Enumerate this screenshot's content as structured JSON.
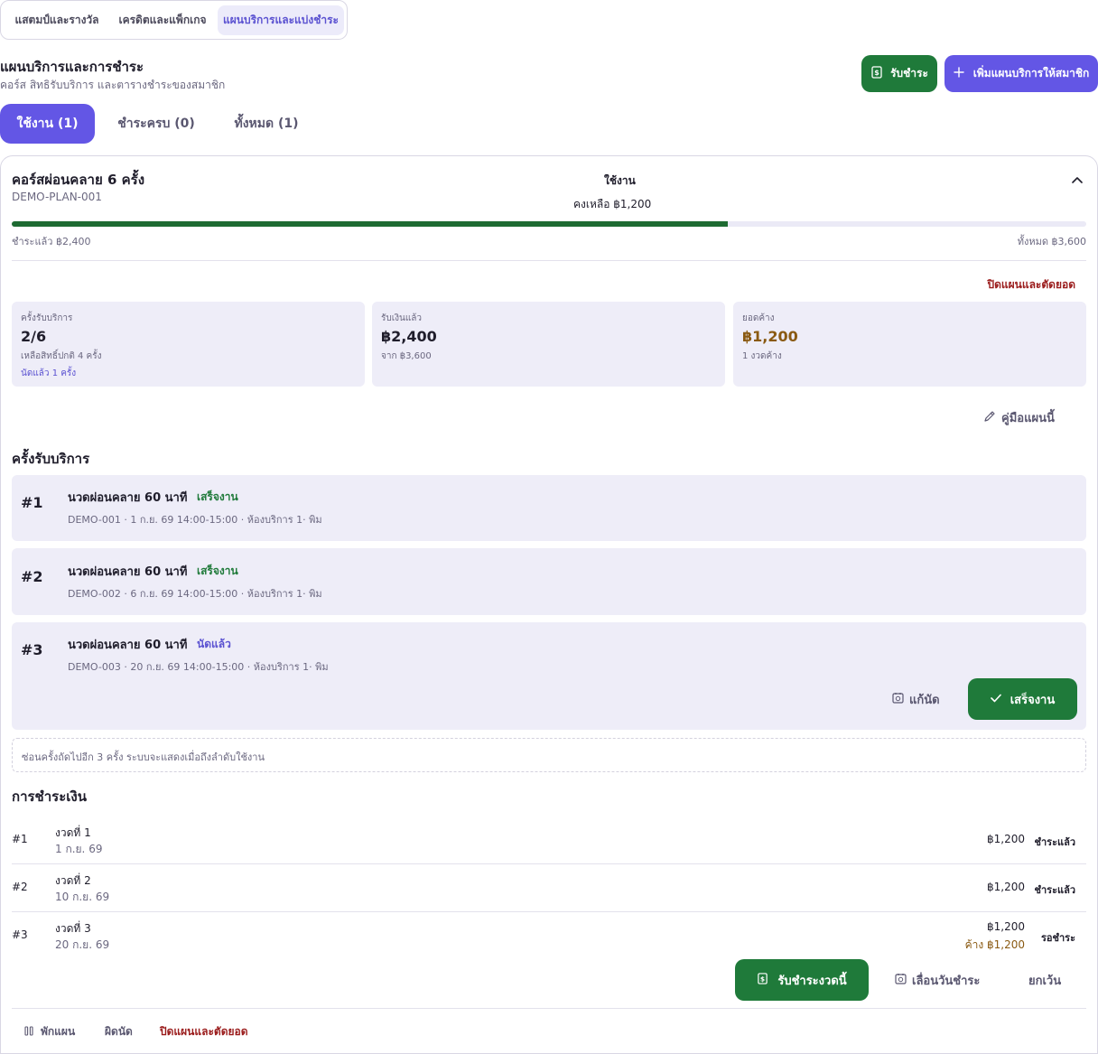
{
  "top_tabs": [
    "แสตมป์และรางวัล",
    "เครดิตและแพ็กเกจ",
    "แผนบริการและแบ่งชำระ"
  ],
  "header": {
    "title": "แผนบริการและการชำระ",
    "subtitle": "คอร์ส สิทธิรับบริการ และตารางชำระของสมาชิก",
    "receive_label": "รับชำระ",
    "add_plan_label": "เพิ่มแผนบริการให้สมาชิก"
  },
  "status_tabs": [
    "ใช้งาน (1)",
    "ชำระครบ (0)",
    "ทั้งหมด (1)"
  ],
  "plan": {
    "name": "คอร์สผ่อนคลาย 6 ครั้ง",
    "code": "DEMO-PLAN-001",
    "status": "ใช้งาน",
    "remaining": "คงเหลือ ฿1,200",
    "paid_fraction": 0.6667,
    "paid_label": "ชำระแล้ว ฿2,400",
    "total_label": "ทั้งหมด ฿3,600",
    "close_label": "ปิดแผนและตัดยอด",
    "stats": {
      "sessions": {
        "label": "ครั้งรับบริการ",
        "value": "2/6",
        "sub": "เหลือสิทธิ์ปกติ 4 ครั้ง",
        "sub2": "นัดแล้ว 1 ครั้ง"
      },
      "received": {
        "label": "รับเงินแล้ว",
        "value": "฿2,400",
        "sub": "จาก ฿3,600"
      },
      "outstanding": {
        "label": "ยอดค้าง",
        "value": "฿1,200",
        "sub": "1 งวดค้าง"
      }
    },
    "guide_label": "คู่มือแผนนี้"
  },
  "visits_section": {
    "title": "ครั้งรับบริการ",
    "items": [
      {
        "num": "#1",
        "title": "นวดผ่อนคลาย 60 นาที",
        "status": "เสร็จงาน",
        "meta": "DEMO-001 · 1 ก.ย. 69 14:00-15:00 · ห้องบริการ 1· พิม"
      },
      {
        "num": "#2",
        "title": "นวดผ่อนคลาย 60 นาที",
        "status": "เสร็จงาน",
        "meta": "DEMO-002 · 6 ก.ย. 69 14:00-15:00 · ห้องบริการ 1· พิม"
      },
      {
        "num": "#3",
        "title": "นวดผ่อนคลาย 60 นาที",
        "status": "นัดแล้ว",
        "meta": "DEMO-003 · 20 ก.ย. 69 14:00-15:00 · ห้องบริการ 1· พิม"
      }
    ],
    "reschedule_label": "แก้นัด",
    "complete_label": "เสร็จงาน",
    "hidden_note": "ซ่อนครั้งถัดไปอีก 3 ครั้ง ระบบจะแสดงเมื่อถึงลำดับใช้งาน"
  },
  "payments_section": {
    "title": "การชำระเงิน",
    "rows": [
      {
        "num": "#1",
        "label": "งวดที่ 1",
        "date": "1 ก.ย. 69",
        "amount": "฿1,200",
        "owe": "",
        "status": "ชำระแล้ว"
      },
      {
        "num": "#2",
        "label": "งวดที่ 2",
        "date": "10 ก.ย. 69",
        "amount": "฿1,200",
        "owe": "",
        "status": "ชำระแล้ว"
      },
      {
        "num": "#3",
        "label": "งวดที่ 3",
        "date": "20 ก.ย. 69",
        "amount": "฿1,200",
        "owe": "ค้าง ฿1,200",
        "status": "รอชำระ"
      }
    ],
    "receive_installment_label": "รับชำระงวดนี้",
    "postpone_label": "เลื่อนวันชำระ",
    "waive_label": "ยกเว้น"
  },
  "footer_actions": {
    "pause": "พักแผน",
    "no_show": "ผิดนัด",
    "close": "ปิดแผนและตัดยอด"
  },
  "colors": {
    "primary": "#6356e5",
    "success": "#1f7a3a",
    "danger": "#9a1b1b",
    "warning": "#8a5a12"
  }
}
